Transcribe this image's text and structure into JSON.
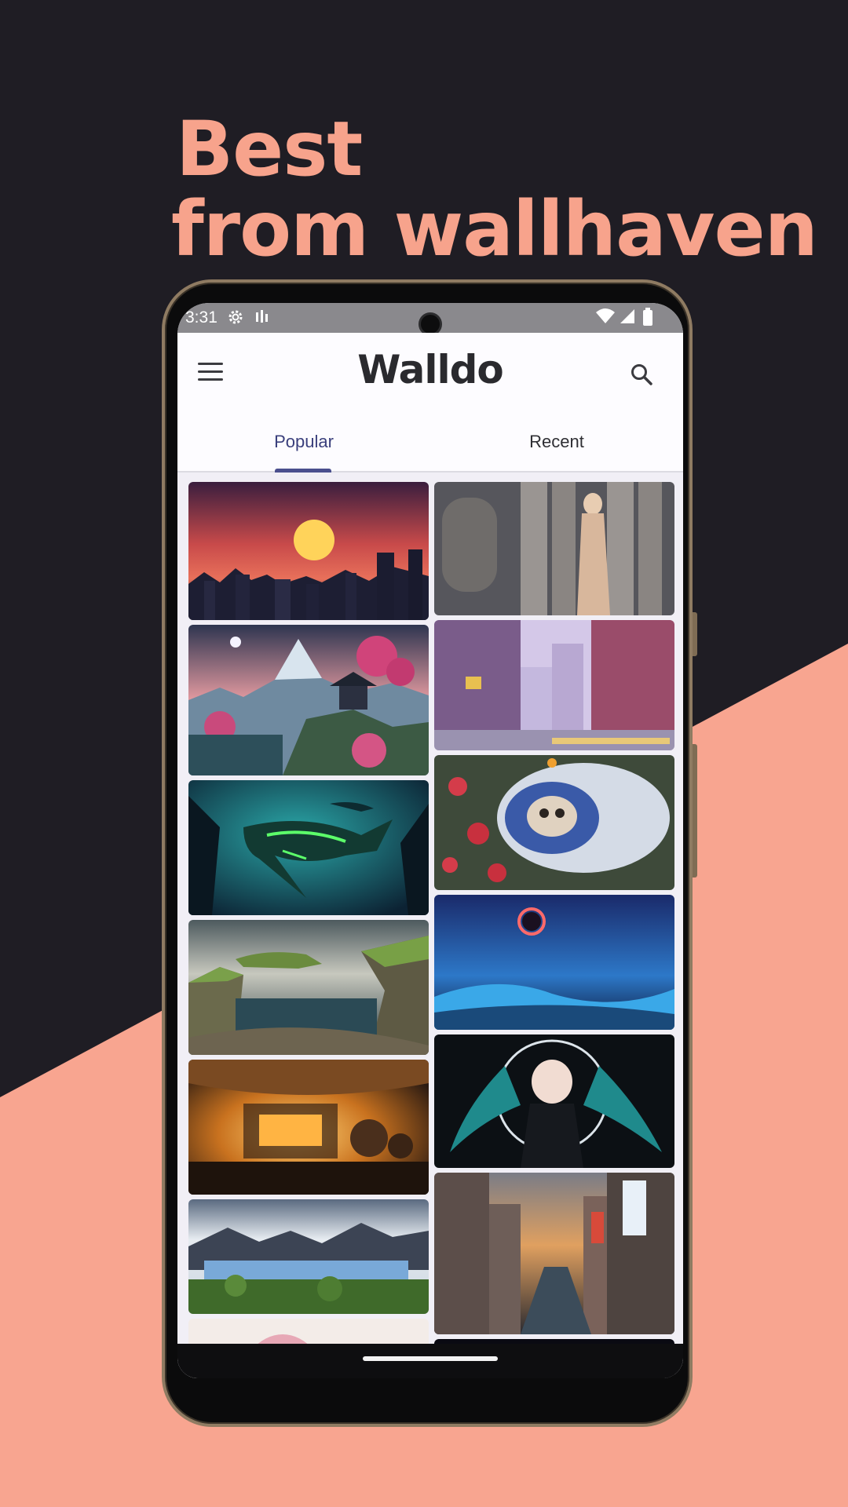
{
  "promo": {
    "headline_line1": "Best",
    "headline_line2": "from wallhaven"
  },
  "colors": {
    "background_dark": "#1f1d24",
    "background_accent": "#f8a590",
    "headline": "#f7a38c",
    "primary": "#3f4480",
    "tab_active": "#3a3f7c"
  },
  "status_bar": {
    "time": "3:31",
    "left_icons": [
      "settings-gear-icon",
      "sound-bars-icon"
    ],
    "right_icons": [
      "wifi-icon",
      "cell-signal-icon",
      "battery-icon"
    ]
  },
  "app": {
    "title": "Walldo",
    "menu_icon": "hamburger-menu-icon",
    "search_icon": "search-icon"
  },
  "tabs": [
    {
      "label": "Popular",
      "selected": true
    },
    {
      "label": "Recent",
      "selected": false
    }
  ],
  "wallpapers": {
    "left_column": [
      "pixel-art-sunset-city",
      "pixel-art-pagoda-mountain",
      "glowing-green-shark-underwater",
      "sea-cliffs-waterfall",
      "orange-workshop-interior",
      "glacier-mountain-landscape",
      "pink-hair-anime-girl"
    ],
    "right_column": [
      "elf-woman-columns",
      "anime-city-street",
      "astronaut-skull-flowers",
      "blue-eclipse-sky",
      "anime-twin-tails-girl",
      "osaka-canal-street",
      "colorful-trees-night"
    ]
  },
  "fab": {
    "icon": "settings-gear-icon"
  }
}
